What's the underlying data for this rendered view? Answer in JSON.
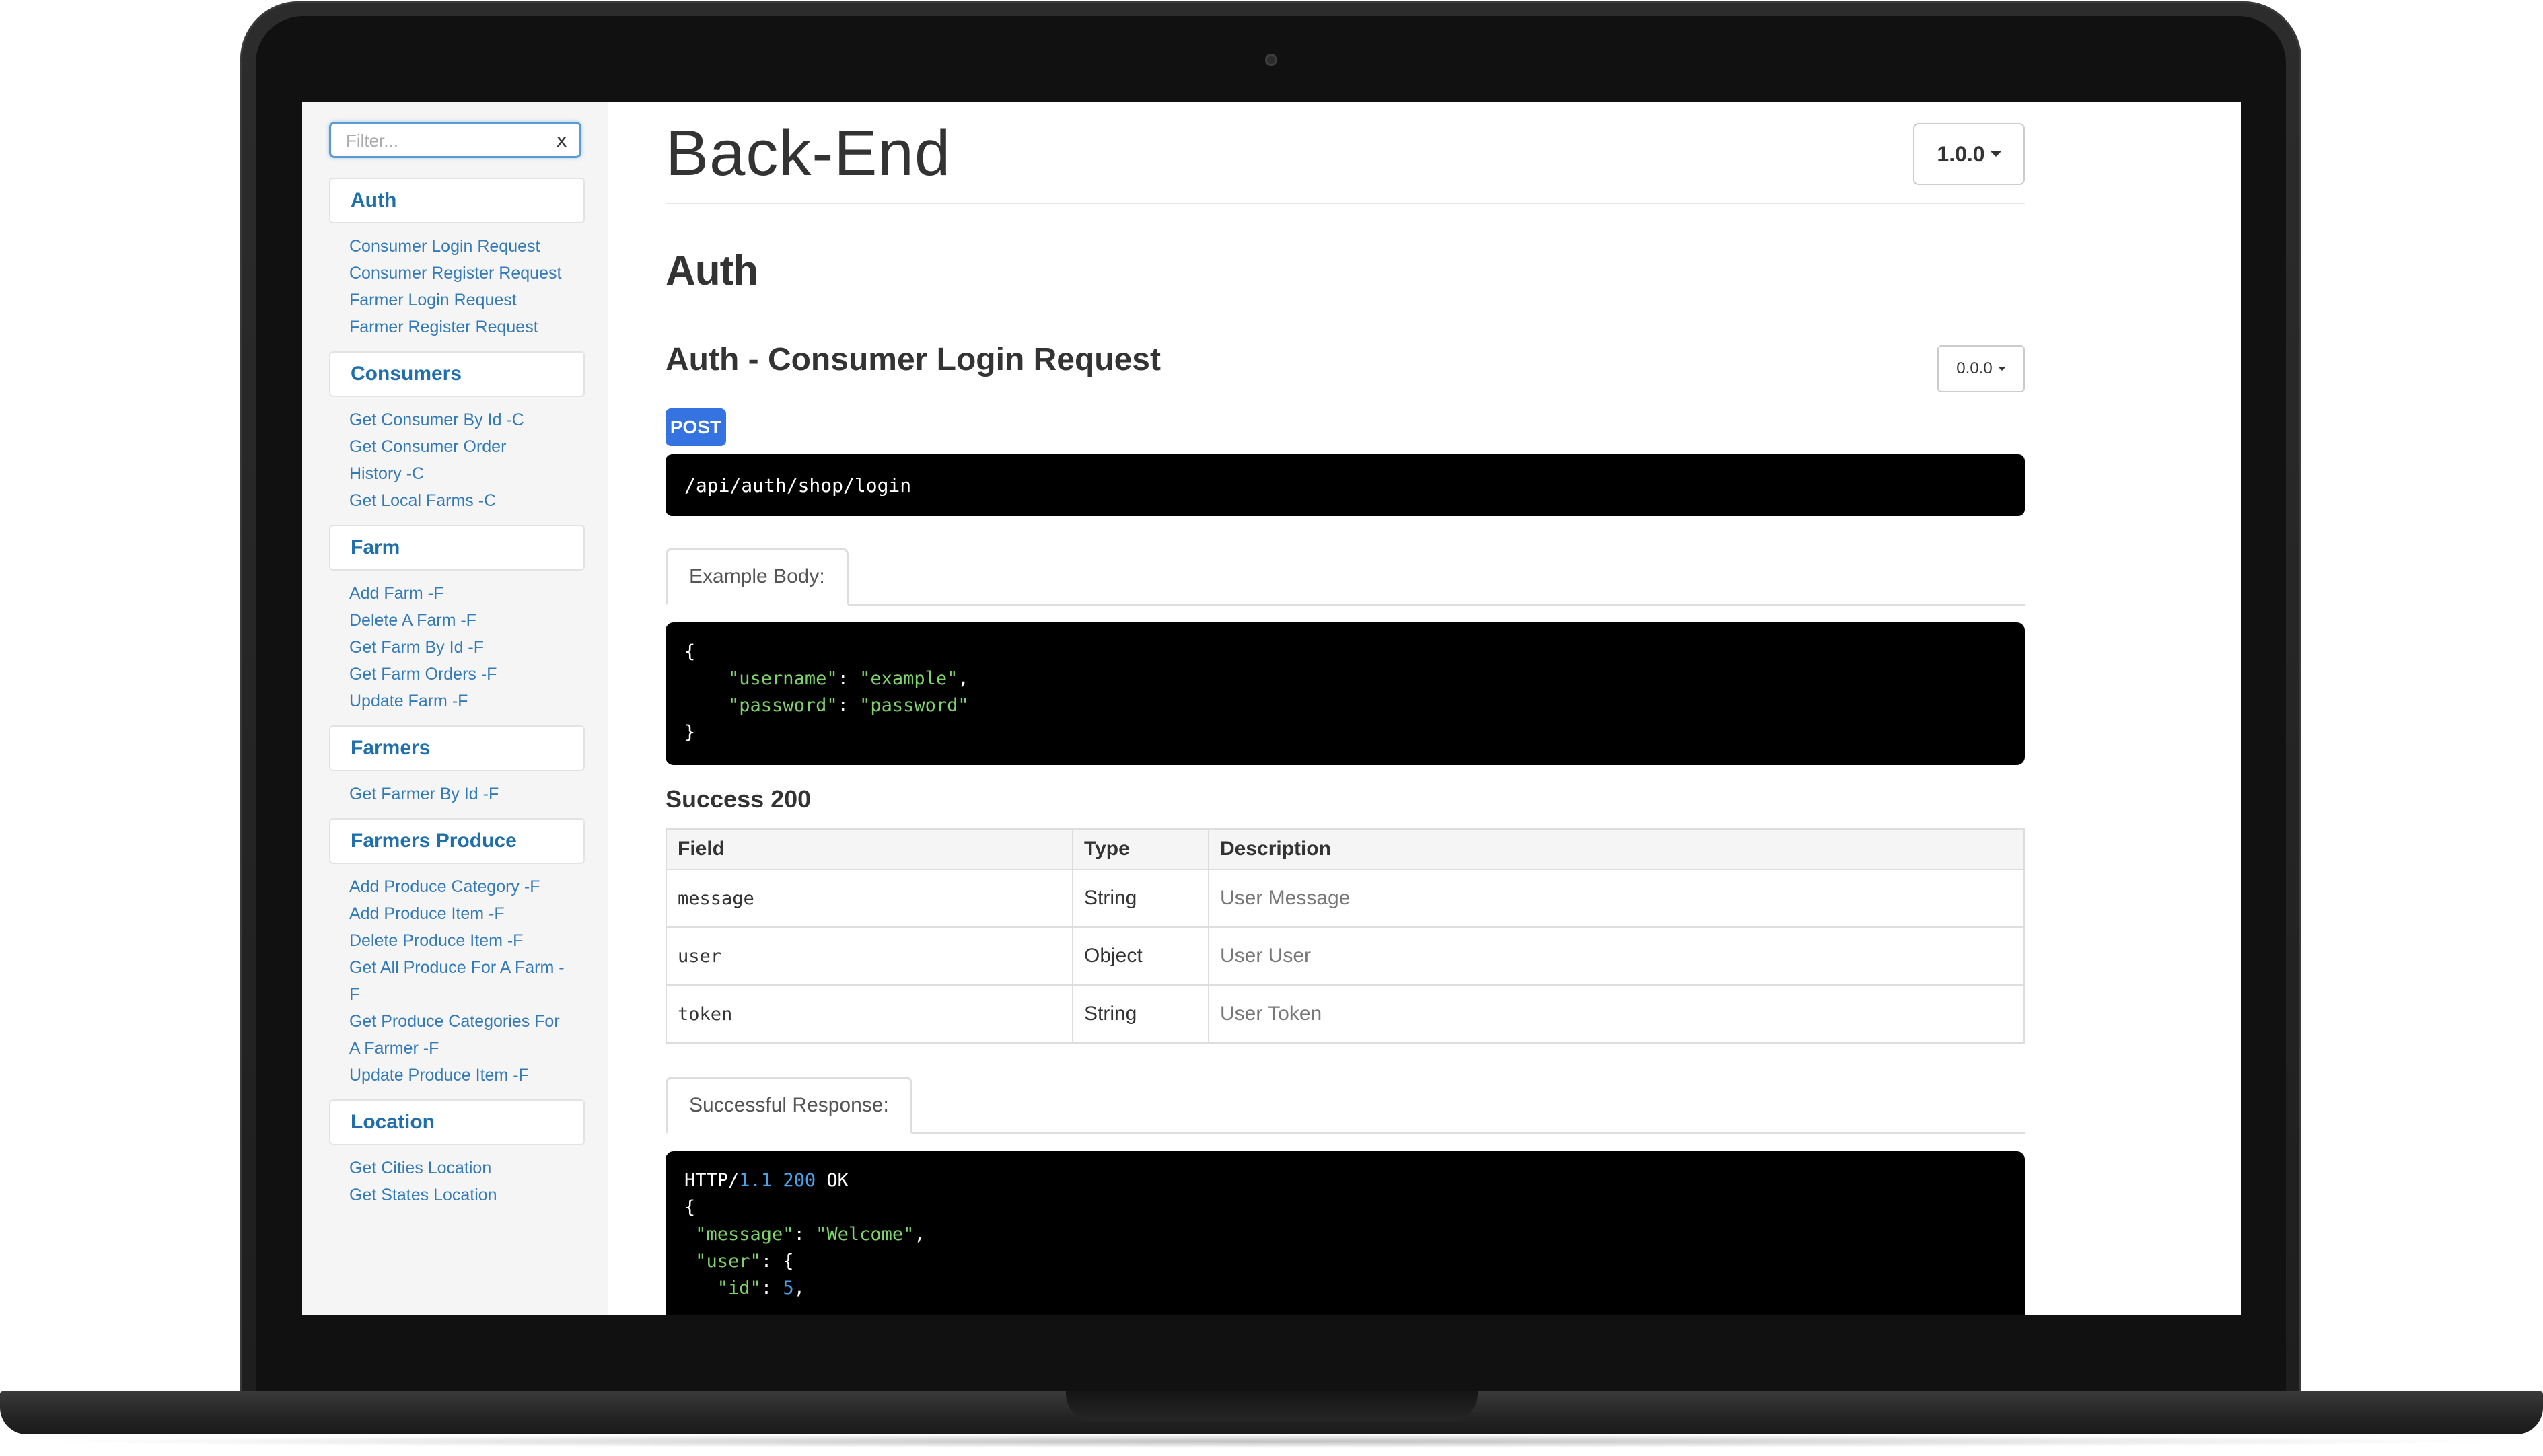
{
  "sidebar": {
    "filter_placeholder": "Filter...",
    "filter_clear": "x",
    "groups": [
      {
        "title": "Auth",
        "items": [
          "Consumer Login Request",
          "Consumer Register Request",
          "Farmer Login Request",
          "Farmer Register Request"
        ]
      },
      {
        "title": "Consumers",
        "items": [
          "Get Consumer By Id -C",
          "Get Consumer Order History -C",
          "Get Local Farms -C"
        ]
      },
      {
        "title": "Farm",
        "items": [
          "Add Farm -F",
          "Delete A Farm -F",
          "Get Farm By Id -F",
          "Get Farm Orders -F",
          "Update Farm -F"
        ]
      },
      {
        "title": "Farmers",
        "items": [
          "Get Farmer By Id -F"
        ]
      },
      {
        "title": "Farmers Produce",
        "items": [
          "Add Produce Category -F",
          "Add Produce Item -F",
          "Delete Produce Item -F",
          "Get All Produce For A Farm -F",
          "Get Produce Categories For A Farmer -F",
          "Update Produce Item -F"
        ]
      },
      {
        "title": "Location",
        "items": [
          "Get Cities Location",
          "Get States Location"
        ]
      }
    ]
  },
  "main": {
    "title": "Back-End",
    "version": "1.0.0",
    "section": "Auth",
    "endpoint": {
      "title": "Auth - Consumer Login Request",
      "version": "0.0.0",
      "method": "POST",
      "method_color": "#3574e0",
      "url": "/api/auth/shop/login",
      "example_tab": "Example Body:",
      "example_body": {
        "open": "{",
        "line1_key": "\"username\"",
        "line1_val": "\"example\"",
        "line2_key": "\"password\"",
        "line2_val": "\"password\"",
        "close": "}"
      },
      "success_heading": "Success 200",
      "table": {
        "headers": [
          "Field",
          "Type",
          "Description"
        ],
        "rows": [
          [
            "message",
            "String",
            "User Message"
          ],
          [
            "user",
            "Object",
            "User User"
          ],
          [
            "token",
            "String",
            "User Token"
          ]
        ]
      },
      "response_tab": "Successful Response:",
      "response": {
        "status_proto": "HTTP/",
        "status_version": "1.1",
        "status_code": "200",
        "status_text": "OK",
        "open": "{",
        "message_key": "\"message\"",
        "message_val": "\"Welcome\"",
        "user_key": "\"user\"",
        "id_key": "\"id\"",
        "id_val": "5"
      }
    }
  }
}
